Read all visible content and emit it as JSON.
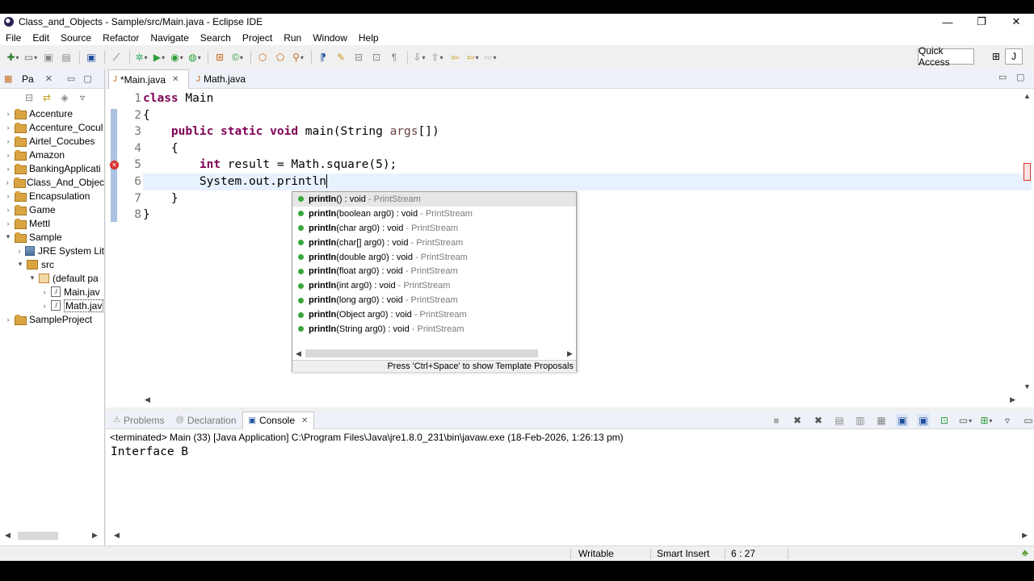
{
  "window": {
    "title": "Class_and_Objects - Sample/src/Main.java - Eclipse IDE",
    "controls": {
      "minimize": "—",
      "maximize": "❐",
      "close": "✕"
    }
  },
  "menu": [
    "File",
    "Edit",
    "Source",
    "Refactor",
    "Navigate",
    "Search",
    "Project",
    "Run",
    "Window",
    "Help"
  ],
  "toolbar": {
    "quick_access": "Quick Access"
  },
  "package_explorer": {
    "tab_label": "Pa",
    "tree": [
      {
        "label": "Accenture",
        "type": "project",
        "depth": 0,
        "expanded": false
      },
      {
        "label": "Accenture_Cocul",
        "type": "project",
        "depth": 0,
        "expanded": false
      },
      {
        "label": "Airtel_Cocubes",
        "type": "project",
        "depth": 0,
        "expanded": false
      },
      {
        "label": "Amazon",
        "type": "project",
        "depth": 0,
        "expanded": false
      },
      {
        "label": "BankingApplicati",
        "type": "project",
        "depth": 0,
        "expanded": false
      },
      {
        "label": "Class_And_Objec",
        "type": "project",
        "depth": 0,
        "expanded": false
      },
      {
        "label": "Encapsulation",
        "type": "project",
        "depth": 0,
        "expanded": false
      },
      {
        "label": "Game",
        "type": "project",
        "depth": 0,
        "expanded": false
      },
      {
        "label": "Mettl",
        "type": "project",
        "depth": 0,
        "expanded": false
      },
      {
        "label": "Sample",
        "type": "project",
        "depth": 0,
        "expanded": true
      },
      {
        "label": "JRE System Lit",
        "type": "library",
        "depth": 1,
        "expanded": false
      },
      {
        "label": "src",
        "type": "src",
        "depth": 1,
        "expanded": true
      },
      {
        "label": "(default pa",
        "type": "package",
        "depth": 2,
        "expanded": true
      },
      {
        "label": "Main.jav",
        "type": "java",
        "depth": 3,
        "expanded": false
      },
      {
        "label": "Math.jav",
        "type": "java",
        "depth": 3,
        "expanded": false,
        "selected": true
      },
      {
        "label": "SampleProject",
        "type": "project",
        "depth": 0,
        "expanded": false
      }
    ]
  },
  "editor": {
    "tabs": [
      {
        "label": "*Main.java",
        "active": true
      },
      {
        "label": "Math.java",
        "active": false
      }
    ],
    "lines": [
      {
        "no": "1"
      },
      {
        "no": "2"
      },
      {
        "no": "3"
      },
      {
        "no": "4"
      },
      {
        "no": "5"
      },
      {
        "no": "6"
      },
      {
        "no": "7"
      },
      {
        "no": "8"
      }
    ],
    "code": {
      "l1_kw": "class",
      "l1_rest": " Main",
      "l2": "{",
      "l3_indent": "    ",
      "l3_kw": "public static void",
      "l3_rest": " main(String ",
      "l3_param": "args",
      "l3_end": "[])",
      "l4": "    {",
      "l5_indent": "        ",
      "l5_kw": "int",
      "l5_rest": " result = Math.square(5);",
      "l6": "        System.out.println",
      "l7": "    }",
      "l8": "}"
    }
  },
  "completion": {
    "items": [
      {
        "name": "println",
        "sig": "() : void",
        "owner": " - PrintStream"
      },
      {
        "name": "println",
        "sig": "(boolean arg0) : void",
        "owner": " - PrintStream"
      },
      {
        "name": "println",
        "sig": "(char arg0) : void",
        "owner": " - PrintStream"
      },
      {
        "name": "println",
        "sig": "(char[] arg0) : void",
        "owner": " - PrintStream"
      },
      {
        "name": "println",
        "sig": "(double arg0) : void",
        "owner": " - PrintStream"
      },
      {
        "name": "println",
        "sig": "(float arg0) : void",
        "owner": " - PrintStream"
      },
      {
        "name": "println",
        "sig": "(int arg0) : void",
        "owner": " - PrintStream"
      },
      {
        "name": "println",
        "sig": "(long arg0) : void",
        "owner": " - PrintStream"
      },
      {
        "name": "println",
        "sig": "(Object arg0) : void",
        "owner": " - PrintStream"
      },
      {
        "name": "println",
        "sig": "(String arg0) : void",
        "owner": " - PrintStream"
      }
    ],
    "footer": "Press 'Ctrl+Space' to show Template Proposals"
  },
  "bottom_panel": {
    "tabs": [
      "Problems",
      "Declaration",
      "Console"
    ],
    "active_tab": "Console",
    "status_line": "<terminated> Main (33) [Java Application] C:\\Program Files\\Java\\jre1.8.0_231\\bin\\javaw.exe (18-Feb-2026, 1:26:13 pm)",
    "output": "Interface B"
  },
  "statusbar": {
    "writable": "Writable",
    "insert_mode": "Smart Insert",
    "position": "6 : 27"
  }
}
